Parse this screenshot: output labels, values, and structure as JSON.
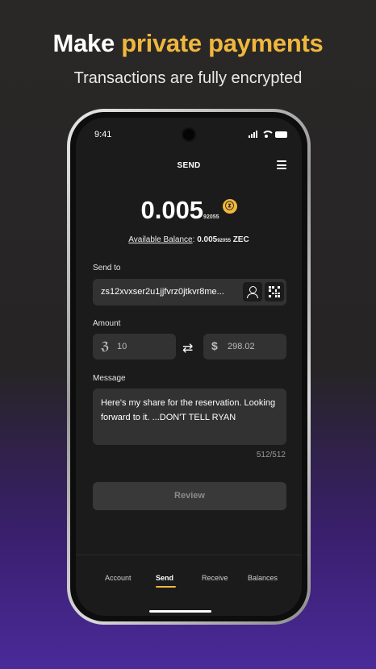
{
  "hero": {
    "title_prefix": "Make",
    "title_highlight": "private payments",
    "subtitle": "Transactions are fully encrypted"
  },
  "status_bar": {
    "time": "9:41"
  },
  "header": {
    "title": "SEND"
  },
  "amount": {
    "main": "0.005",
    "small_digits": "92055",
    "currency_symbol": "ⓩ"
  },
  "balance": {
    "label": "Available Balance",
    "value": "0.005",
    "small_digits": "92055",
    "unit": "ZEC"
  },
  "send_to": {
    "label": "Send to",
    "address": "zs12xvxser2u1jjfvrz0jtkvr8me..."
  },
  "amount_fields": {
    "label": "Amount",
    "zec_symbol": "ℨ",
    "zec_value": "10",
    "usd_symbol": "$",
    "usd_value": "298.02"
  },
  "message": {
    "label": "Message",
    "text": "Here's my share for the reservation. Looking forward to it. ...DON'T TELL RYAN",
    "counter": "512/512"
  },
  "review_button": {
    "label": "Review"
  },
  "tabs": [
    {
      "label": "Account"
    },
    {
      "label": "Send"
    },
    {
      "label": "Receive"
    },
    {
      "label": "Balances"
    }
  ],
  "colors": {
    "accent": "#f0b73d",
    "background": "#1c1b1b",
    "field": "#333232"
  }
}
